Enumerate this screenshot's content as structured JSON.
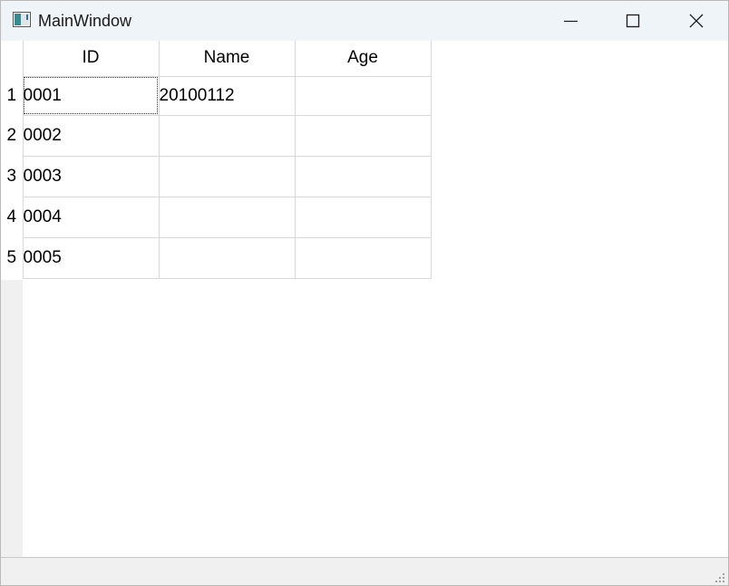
{
  "window": {
    "title": "MainWindow",
    "icons": {
      "app": "app-window-icon",
      "minimize": "minimize-icon",
      "maximize": "maximize-icon",
      "close": "close-icon"
    }
  },
  "table": {
    "columns": [
      "ID",
      "Name",
      "Age"
    ],
    "rows": [
      {
        "header": "1",
        "cells": [
          "0001",
          "20100112",
          ""
        ]
      },
      {
        "header": "2",
        "cells": [
          "0002",
          "",
          ""
        ]
      },
      {
        "header": "3",
        "cells": [
          "0003",
          "",
          ""
        ]
      },
      {
        "header": "4",
        "cells": [
          "0004",
          "",
          ""
        ]
      },
      {
        "header": "5",
        "cells": [
          "0005",
          "",
          ""
        ]
      }
    ]
  },
  "colors": {
    "titlebar_bg": "#eff4f9",
    "grid_line": "#d8d8d8",
    "header_strip": "#f0f0f0"
  }
}
